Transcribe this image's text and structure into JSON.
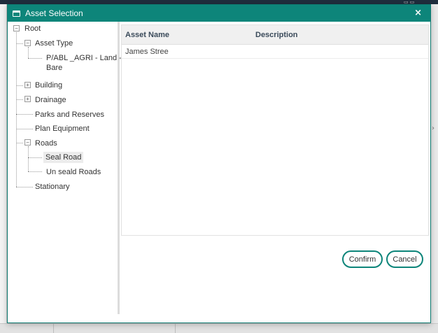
{
  "dialog": {
    "title": "Asset Selection",
    "close_label": "×"
  },
  "tree": {
    "root": "Root",
    "asset_type": "Asset Type",
    "asset_type_child_line1": "P/ABL _AGRI - Land -",
    "asset_type_child_line2": "Bare",
    "building": "Building",
    "drainage": "Drainage",
    "parks": "Parks and Reserves",
    "plan_equipment": "Plan Equipment",
    "roads": "Roads",
    "seal_road": "Seal Road",
    "unseald_roads": "Un seald Roads",
    "stationary": "Stationary",
    "expand_symbol": "+",
    "collapse_symbol": "−"
  },
  "grid": {
    "headers": [
      "Asset Name",
      "Description"
    ],
    "rows": [
      {
        "name": "James Stree",
        "description": ""
      }
    ]
  },
  "buttons": {
    "confirm": "Confirm",
    "cancel": "Cancel"
  }
}
